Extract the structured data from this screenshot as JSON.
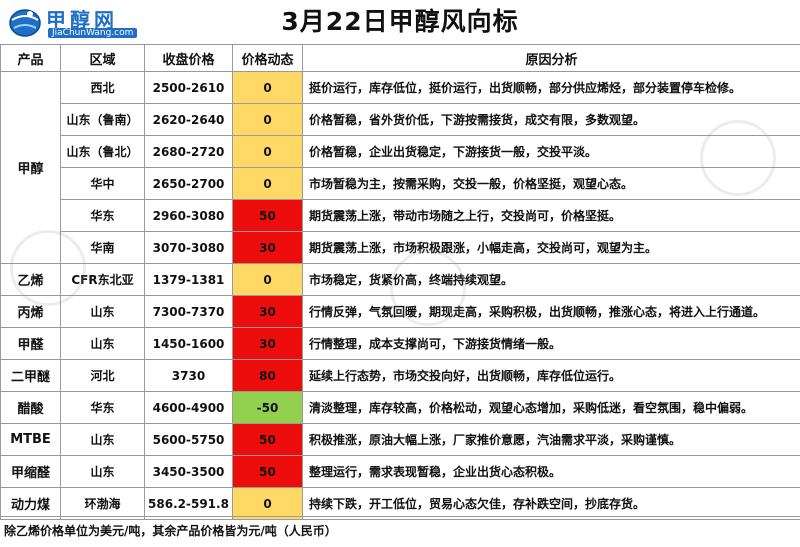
{
  "header": {
    "logo_cn": "甲醇网",
    "logo_en": "JiaChunWang.com",
    "title": "3月22日甲醇风向标"
  },
  "table": {
    "columns": [
      "产品",
      "区域",
      "收盘价格",
      "价格动态",
      "原因分析"
    ],
    "groups": [
      {
        "product": "甲醇",
        "rows": [
          {
            "region": "西北",
            "price": "2500-2610",
            "change": "0",
            "level": "zero",
            "reason": "挺价运行，库存低位，挺价运行，出货顺畅，部分供应烯烃，部分装置停车检修。"
          },
          {
            "region": "山东（鲁南）",
            "price": "2620-2640",
            "change": "0",
            "level": "zero",
            "reason": "价格暂稳，省外货价低，下游按需接货，成交有限，多数观望。"
          },
          {
            "region": "山东（鲁北）",
            "price": "2680-2720",
            "change": "0",
            "level": "zero",
            "reason": "价格暂稳，企业出货稳定，下游接货一般，交投平淡。"
          },
          {
            "region": "华中",
            "price": "2650-2700",
            "change": "0",
            "level": "zero",
            "reason": "市场暂稳为主，按需采购，交投一般，价格坚挺，观望心态。"
          },
          {
            "region": "华东",
            "price": "2960-3080",
            "change": "50",
            "level": "up",
            "reason": "期货震荡上涨，带动市场随之上行，交投尚可，价格坚挺。"
          },
          {
            "region": "华南",
            "price": "3070-3080",
            "change": "30",
            "level": "up",
            "reason": "期货震荡上涨，市场积极跟涨，小幅走高，交投尚可，观望为主。"
          }
        ]
      },
      {
        "product": "乙烯",
        "rows": [
          {
            "region": "CFR东北亚",
            "price": "1379-1381",
            "change": "0",
            "level": "zero",
            "reason": "市场稳定，货紧价高，终端持续观望。"
          }
        ]
      },
      {
        "product": "丙烯",
        "rows": [
          {
            "region": "山东",
            "price": "7300-7370",
            "change": "30",
            "level": "up",
            "reason": "行情反弹，气氛回暖，期现走高，采购积极，出货顺畅，推涨心态，将进入上行通道。"
          }
        ]
      },
      {
        "product": "甲醛",
        "rows": [
          {
            "region": "山东",
            "price": "1450-1600",
            "change": "30",
            "level": "up",
            "reason": "行情整理，成本支撑尚可，下游接货情绪一般。"
          }
        ]
      },
      {
        "product": "二甲醚",
        "rows": [
          {
            "region": "河北",
            "price": "3730",
            "change": "80",
            "level": "up",
            "reason": "延续上行态势，市场交投向好，出货顺畅，库存低位运行。"
          }
        ]
      },
      {
        "product": "醋酸",
        "rows": [
          {
            "region": "华东",
            "price": "4600-4900",
            "change": "-50",
            "level": "down",
            "reason": "清淡整理，库存较高，价格松动，观望心态增加，采购低迷，看空氛围，稳中偏弱。"
          }
        ]
      },
      {
        "product": "MTBE",
        "rows": [
          {
            "region": "山东",
            "price": "5600-5750",
            "change": "50",
            "level": "up",
            "reason": "积极推涨，原油大幅上涨，厂家推价意愿，汽油需求平淡，采购谨慎。"
          }
        ]
      },
      {
        "product": "甲缩醛",
        "rows": [
          {
            "region": "山东",
            "price": "3450-3500",
            "change": "50",
            "level": "up",
            "reason": "整理运行，需求表现暂稳，企业出货心态积极。"
          }
        ]
      },
      {
        "product": "动力煤",
        "rows": [
          {
            "region": "环渤海",
            "price": "586.2-591.8",
            "change": "0",
            "level": "zero",
            "reason": "持续下跌，开工低位，贸易心态欠佳，存补跌空间，抄底存货。"
          }
        ]
      }
    ]
  },
  "footer": {
    "note": "除乙烯价格单位为美元/吨，其余产品价格皆为元/吨（人民币）"
  },
  "colors": {
    "up": "#ee0d0d",
    "zero": "#ffd966",
    "down": "#92d050"
  }
}
